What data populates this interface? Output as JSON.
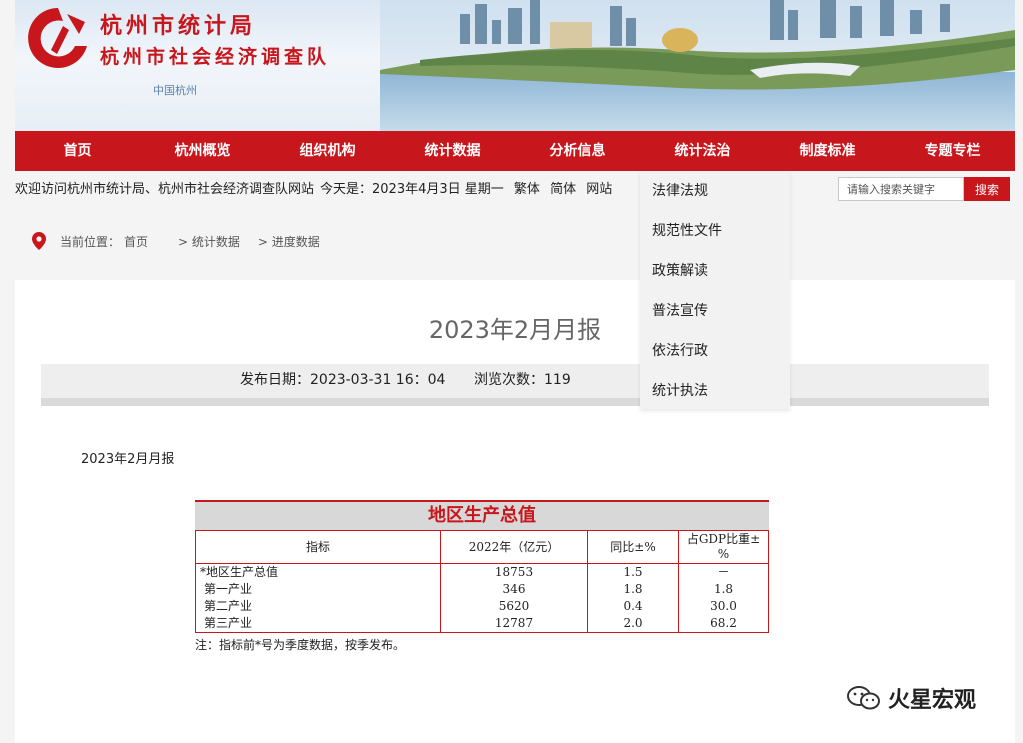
{
  "header": {
    "title_line1": "杭州市统计局",
    "title_line2": "杭州市社会经济调查队",
    "sub_logo_text": "中国杭州"
  },
  "nav": {
    "items": [
      "首页",
      "杭州概览",
      "组织机构",
      "统计数据",
      "分析信息",
      "统计法治",
      "制度标准",
      "专题专栏"
    ]
  },
  "infobar": {
    "welcome": "欢迎访问杭州市统计局、杭州市社会经济调查队网站",
    "date": "今天是：2023年4月3日 星期一",
    "traditional": "繁体",
    "simplified": "简体",
    "more": "网站"
  },
  "search": {
    "placeholder": "请输入搜索关键字",
    "button": "搜索"
  },
  "dropdown": {
    "items": [
      "法律法规",
      "规范性文件",
      "政策解读",
      "普法宣传",
      "依法行政",
      "统计执法"
    ]
  },
  "breadcrumb": {
    "label": "当前位置：",
    "home": "首页",
    "level1": "> 统计数据",
    "level2": "> 进度数据"
  },
  "article": {
    "title": "2023年2月月报",
    "publish_date": "发布日期：2023-03-31 16：04",
    "views": "浏览次数：119",
    "subtitle": "2023年2月月报"
  },
  "table": {
    "title": "地区生产总值",
    "headers": [
      "指标",
      "2022年（亿元）",
      "同比±%",
      "占GDP比重±%"
    ],
    "rows": [
      [
        "*地区生产总值",
        "18753",
        "1.5",
        "－"
      ],
      [
        "第一产业",
        "346",
        "1.8",
        "1.8"
      ],
      [
        "第二产业",
        "5620",
        "0.4",
        "30.0"
      ],
      [
        "第三产业",
        "12787",
        "2.0",
        "68.2"
      ]
    ],
    "note": "注：指标前*号为季度数据，按季发布。"
  },
  "watermark": {
    "text": "火星宏观"
  },
  "colors": {
    "brand_red": "#c8161d",
    "page_bg": "#f4f4f4"
  }
}
